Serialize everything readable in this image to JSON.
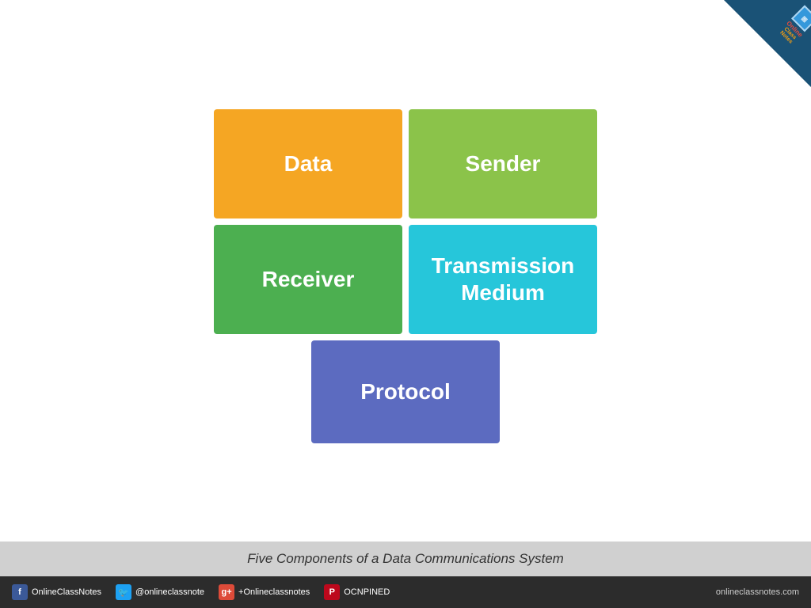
{
  "page": {
    "background": "#ffffff"
  },
  "corner": {
    "online_label": "Online",
    "classnotes_label": "Class Notes"
  },
  "boxes": {
    "data_label": "Data",
    "sender_label": "Sender",
    "receiver_label": "Receiver",
    "transmission_label": "Transmission\nMedium",
    "transmission_line1": "Transmission",
    "transmission_line2": "Medium",
    "protocol_label": "Protocol"
  },
  "caption": {
    "text": "Five Components of a Data Communications System"
  },
  "footer": {
    "facebook_label": "OnlineClassNotes",
    "twitter_label": "@onlineclassnote",
    "googleplus_label": "+Onlineclassnotes",
    "pinterest_label": "OCNPINED",
    "website": "onlineclassnotes.com"
  }
}
